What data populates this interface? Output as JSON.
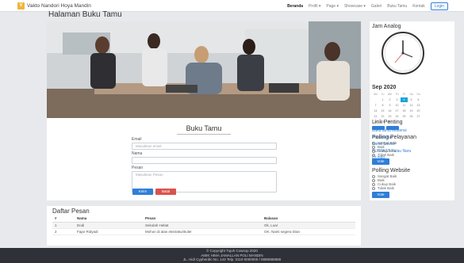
{
  "brand": {
    "logo_letter": "V",
    "title": "Vakto Nandori Hoya Mandin"
  },
  "nav": {
    "items": [
      "Beranda",
      "Profil ▾",
      "Page ▾",
      "Showcase ▾",
      "Galeri",
      "Buku Tamu",
      "Kontak"
    ],
    "login": "Login"
  },
  "page_title": "Halaman Buku Tamu",
  "guestbook": {
    "title": "Buku Tamu",
    "email_label": "Email",
    "email_placeholder": "Masukkan email",
    "name_label": "Nama",
    "name_value": "",
    "message_label": "Pesan",
    "message_placeholder": "Masukkan Pesan",
    "submit_label": "Kirim",
    "reset_label": "Batal"
  },
  "messages": {
    "title": "Daftar Pesan",
    "columns": [
      "#",
      "Nama",
      "Pesan",
      "Balasan"
    ],
    "rows": [
      [
        "1",
        "Dodi",
        "Sekolah Hebat",
        "Ok, Luar"
      ],
      [
        "2",
        "Fajar Ridyadi",
        "Mohon di atas ekstrakurikuler",
        "OK, Nanti segera Dian"
      ]
    ]
  },
  "sidebar": {
    "clock_title": "Jam Analog",
    "calendar": {
      "month": "Sep 2020",
      "days_of_week": [
        "Mo",
        "Tu",
        "We",
        "Th",
        "Fr",
        "Sa",
        "Su"
      ],
      "cells": [
        "",
        "1",
        "2",
        "3",
        "4",
        "5",
        "6",
        "7",
        "8",
        "9",
        "10",
        "11",
        "12",
        "13",
        "14",
        "15",
        "16",
        "17",
        "18",
        "19",
        "20",
        "21",
        "22",
        "23",
        "24",
        "25",
        "26",
        "27",
        "28",
        "29",
        "30",
        "",
        "",
        "",
        ""
      ],
      "today": "4"
    },
    "links_title": "Link Penting",
    "links": [
      "Buku tamu ekstensi",
      "Pondok Biri",
      "Kanal Sawah",
      "PUSPAST Pulau Naru",
      "Dr.Indo"
    ],
    "poll1": {
      "title": "Polling Pelayanan",
      "options": [
        "Sangat Baik",
        "Baik",
        "Cukup Baik",
        "Tidak Baik"
      ],
      "vote": "Vote"
    },
    "poll2": {
      "title": "Polling Website",
      "options": [
        "Sangat Baik",
        "Baik",
        "Cukup Baik",
        "Tidak Baik"
      ],
      "vote": "Vote"
    }
  },
  "footer": {
    "line1": "© Copyright Tujuh Cowsop 2020",
    "line2": "AMIK HIMA JAMALLAN POLI MANDIN",
    "line3": "JL. Hidi Cypherdin No. 143 Telp. 0110-0000000 / 0888888888"
  }
}
